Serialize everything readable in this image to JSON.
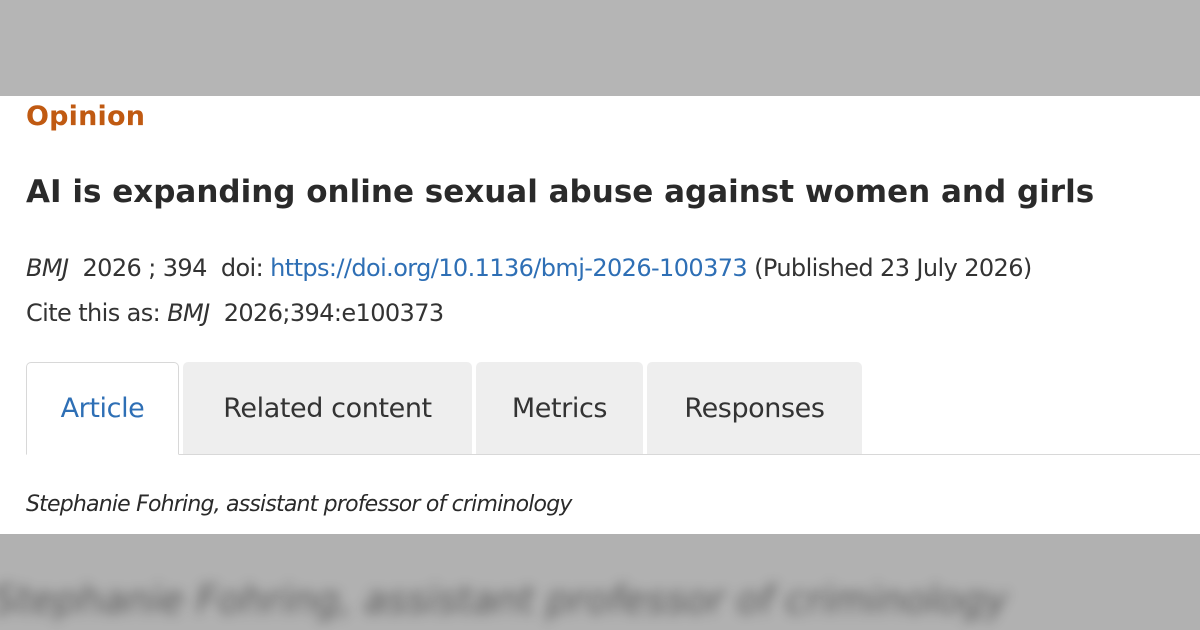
{
  "article": {
    "section_label": "Opinion",
    "title": "AI is expanding online sexual abuse against women and girls",
    "citation": {
      "journal": "BMJ",
      "year": "2026",
      "separator": ";",
      "volume": "394",
      "doi_label": "doi:",
      "doi_url": "https://doi.org/10.1136/bmj-2026-100373",
      "published": "(Published 23 July 2026)"
    },
    "cite_as": {
      "label": "Cite this as:",
      "journal": "BMJ",
      "reference": "2026;394:e100373"
    },
    "author_line": "Stephanie Fohring, assistant professor of criminology"
  },
  "tabs": [
    {
      "label": "Article",
      "active": true
    },
    {
      "label": "Related content",
      "active": false
    },
    {
      "label": "Metrics",
      "active": false
    },
    {
      "label": "Responses",
      "active": false
    }
  ],
  "colors": {
    "section_label": "#c05a12",
    "link": "#2e6fb5",
    "tab_inactive_bg": "#eeeeee",
    "text": "#333333"
  }
}
